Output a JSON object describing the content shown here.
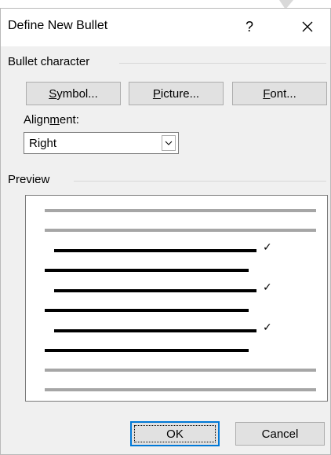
{
  "dialog": {
    "title": "Define New Bullet",
    "help_label": "?",
    "close_icon": "close-icon"
  },
  "bullet_character": {
    "group_label": "Bullet character",
    "buttons": [
      {
        "pre": "",
        "ul": "S",
        "post": "ymbol...",
        "name": "symbol-button"
      },
      {
        "pre": "",
        "ul": "P",
        "post": "icture...",
        "name": "picture-button"
      },
      {
        "pre": "",
        "ul": "F",
        "post": "ont...",
        "name": "font-button"
      }
    ]
  },
  "alignment": {
    "label_pre": "Align",
    "label_ul": "m",
    "label_post": "ent:",
    "value": "Right",
    "arrow_icon": "chevron-down-icon"
  },
  "preview": {
    "label": "Preview",
    "bullet_glyph": "✓",
    "colors": {
      "gray": "#a6a6a6",
      "black": "#000000"
    }
  },
  "footer": {
    "ok_label": "OK",
    "cancel_label": "Cancel"
  }
}
